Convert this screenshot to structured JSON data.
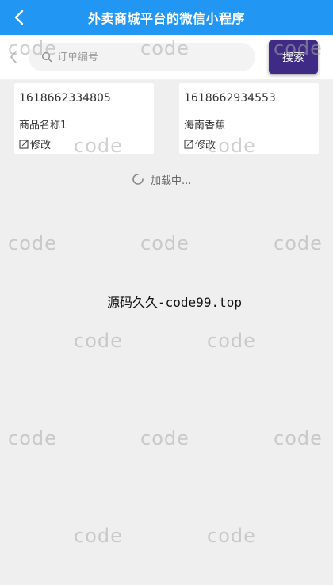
{
  "header": {
    "title": "外卖商城平台的微信小程序",
    "back_icon": "chevron-left-icon"
  },
  "search": {
    "placeholder": "订单编号",
    "value": "",
    "button_label": "搜索",
    "icon": "search-icon"
  },
  "orders": [
    {
      "order_no": "1618662334805",
      "product_name": "商品名称1",
      "edit_label": "修改"
    },
    {
      "order_no": "1618662934553",
      "product_name": "海南香蕉",
      "edit_label": "修改"
    }
  ],
  "loading_text": "加载中...",
  "source_text": "源码久久-code99.top",
  "watermark_text": "code",
  "colors": {
    "header_bg": "#2196f3",
    "search_button_bg": "#3f2a86",
    "page_bg": "#efefef"
  }
}
